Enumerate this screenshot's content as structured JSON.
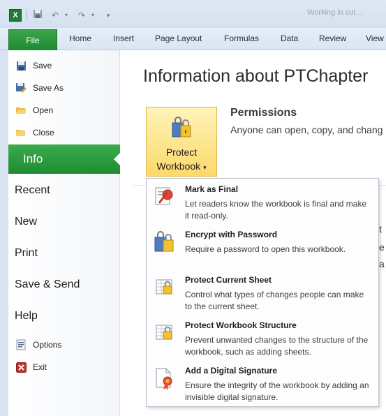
{
  "window": {
    "app_icon_letter": "X",
    "title_fragment": "Working in cut..."
  },
  "quick_access": {
    "save_icon": "save-icon",
    "undo_icon": "undo-icon",
    "redo_icon": "redo-icon",
    "customize_icon": "customize-icon"
  },
  "ribbon": {
    "file_tab": "File",
    "tabs": [
      "Home",
      "Insert",
      "Page Layout",
      "Formulas",
      "Data",
      "Review",
      "View"
    ]
  },
  "backstage": {
    "commands": [
      {
        "label": "Save",
        "icon": "save-icon"
      },
      {
        "label": "Save As",
        "icon": "save-as-icon"
      },
      {
        "label": "Open",
        "icon": "open-folder-icon"
      },
      {
        "label": "Close",
        "icon": "close-folder-icon"
      }
    ],
    "selected": "Info",
    "pages": [
      "Recent",
      "New",
      "Print",
      "Save & Send",
      "Help"
    ],
    "footer_commands": [
      {
        "label": "Options",
        "icon": "options-icon"
      },
      {
        "label": "Exit",
        "icon": "exit-icon"
      }
    ]
  },
  "info": {
    "title": "Information about PTChapter",
    "protect_button": {
      "line1": "Protect",
      "line2": "Workbook",
      "arrow": "▾"
    },
    "permissions_heading": "Permissions",
    "permissions_text": "Anyone can open, copy, and chang",
    "obscured_fragments": [
      "t",
      "e",
      "a"
    ]
  },
  "protect_menu": [
    {
      "title": "Mark as Final",
      "description": "Let readers know the workbook is final and make it read-only.",
      "icon": "mark-final-icon"
    },
    {
      "title": "Encrypt with Password",
      "description": "Require a password to open this workbook.",
      "icon": "encrypt-lock-icon"
    },
    {
      "title": "Protect Current Sheet",
      "description": "Control what types of changes people can make to the current sheet.",
      "icon": "protect-sheet-icon"
    },
    {
      "title": "Protect Workbook Structure",
      "description": "Prevent unwanted changes to the structure of the workbook, such as adding sheets.",
      "icon": "protect-structure-icon"
    },
    {
      "title": "Add a Digital Signature",
      "description": "Ensure the integrity of the workbook by adding an invisible digital signature.",
      "icon": "digital-signature-icon"
    }
  ],
  "colors": {
    "file_green": "#1e8a32",
    "protect_button_gold": "#fcd96b",
    "ribbon_blue": "#dbe6f3"
  }
}
